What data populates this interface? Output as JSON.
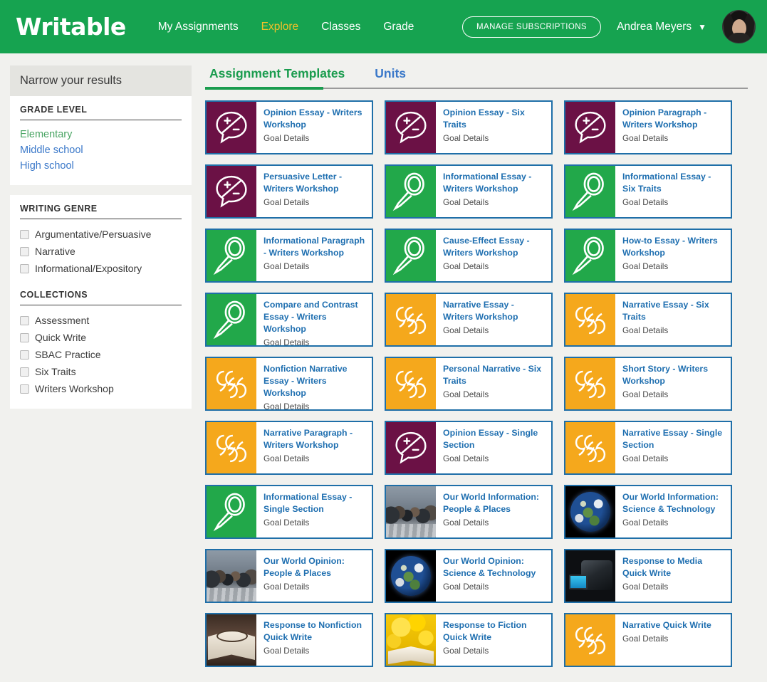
{
  "brand": {
    "name": "Writable"
  },
  "nav": {
    "links": [
      {
        "label": "My Assignments",
        "active": false
      },
      {
        "label": "Explore",
        "active": true
      },
      {
        "label": "Classes",
        "active": false
      },
      {
        "label": "Grade",
        "active": false
      }
    ],
    "manage_subscriptions": "MANAGE SUBSCRIPTIONS",
    "user_name": "Andrea Meyers",
    "caret": "▼"
  },
  "sidebar": {
    "title": "Narrow your results",
    "grade_level": {
      "heading": "GRADE LEVEL",
      "items": [
        {
          "label": "Elementary",
          "selected": true
        },
        {
          "label": "Middle school",
          "selected": false
        },
        {
          "label": "High school",
          "selected": false
        }
      ]
    },
    "writing_genre": {
      "heading": "WRITING GENRE",
      "items": [
        {
          "label": "Argumentative/Persuasive",
          "checked": false
        },
        {
          "label": "Narrative",
          "checked": false
        },
        {
          "label": "Informational/Expository",
          "checked": false
        }
      ]
    },
    "collections": {
      "heading": "COLLECTIONS",
      "items": [
        {
          "label": "Assessment",
          "checked": false
        },
        {
          "label": "Quick Write",
          "checked": false
        },
        {
          "label": "SBAC Practice",
          "checked": false
        },
        {
          "label": "Six Traits",
          "checked": false
        },
        {
          "label": "Writers Workshop",
          "checked": false
        }
      ]
    }
  },
  "main": {
    "tabs": [
      {
        "label": "Assignment Templates",
        "active": true
      },
      {
        "label": "Units",
        "active": false
      }
    ],
    "goal_details_label": "Goal Details",
    "cards": [
      {
        "title": "Opinion Essay - Writers Workshop",
        "icon": "opinion-icon",
        "goal": "Goal Details"
      },
      {
        "title": "Opinion Essay - Six Traits",
        "icon": "opinion-icon",
        "goal": "Goal Details"
      },
      {
        "title": "Opinion Paragraph - Writers Workshop",
        "icon": "opinion-icon",
        "goal": "Goal Details"
      },
      {
        "title": "Persuasive Letter - Writers Workshop",
        "icon": "opinion-icon",
        "goal": "Goal Details"
      },
      {
        "title": "Informational Essay - Writers Workshop",
        "icon": "magnify-icon",
        "goal": "Goal Details"
      },
      {
        "title": "Informational Essay - Six Traits",
        "icon": "magnify-icon",
        "goal": "Goal Details"
      },
      {
        "title": "Informational Paragraph - Writers Workshop",
        "icon": "magnify-icon",
        "goal": "Goal Details"
      },
      {
        "title": "Cause-Effect Essay - Writers Workshop",
        "icon": "magnify-icon",
        "goal": "Goal Details"
      },
      {
        "title": "How-to Essay - Writers Workshop",
        "icon": "magnify-icon",
        "goal": "Goal Details"
      },
      {
        "title": "Compare and Contrast Essay - Writers Workshop",
        "icon": "magnify-icon",
        "goal": "Goal Details"
      },
      {
        "title": "Narrative Essay - Writers Workshop",
        "icon": "quote-icon",
        "goal": "Goal Details"
      },
      {
        "title": "Narrative Essay - Six Traits",
        "icon": "quote-icon",
        "goal": "Goal Details"
      },
      {
        "title": "Nonfiction Narrative Essay - Writers Workshop",
        "icon": "quote-icon",
        "goal": "Goal Details"
      },
      {
        "title": "Personal Narrative - Six Traits",
        "icon": "quote-icon",
        "goal": "Goal Details"
      },
      {
        "title": "Short Story - Writers Workshop",
        "icon": "quote-icon",
        "goal": "Goal Details"
      },
      {
        "title": "Narrative Paragraph - Writers Workshop",
        "icon": "quote-icon",
        "goal": "Goal Details"
      },
      {
        "title": "Opinion Essay - Single Section",
        "icon": "opinion-icon",
        "goal": "Goal Details"
      },
      {
        "title": "Narrative Essay - Single Section",
        "icon": "quote-icon",
        "goal": "Goal Details"
      },
      {
        "title": "Informational Essay - Single Section",
        "icon": "magnify-icon",
        "goal": "Goal Details"
      },
      {
        "title": "Our World Information: People & Places",
        "icon": "crowd-photo",
        "goal": "Goal Details"
      },
      {
        "title": "Our World Information: Science & Technology",
        "icon": "earth-photo",
        "goal": "Goal Details"
      },
      {
        "title": "Our World Opinion: People & Places",
        "icon": "crowd-photo",
        "goal": "Goal Details"
      },
      {
        "title": "Our World Opinion: Science & Technology",
        "icon": "earth-photo",
        "goal": "Goal Details"
      },
      {
        "title": "Response to Media Quick Write",
        "icon": "media-photo",
        "goal": "Goal Details"
      },
      {
        "title": "Response to Nonfiction Quick Write",
        "icon": "book-photo",
        "goal": "Goal Details"
      },
      {
        "title": "Response to Fiction Quick Write",
        "icon": "yellow-book-photo",
        "goal": "Goal Details"
      },
      {
        "title": "Narrative Quick Write",
        "icon": "quote-icon",
        "goal": "Goal Details"
      }
    ]
  },
  "colors": {
    "brand_green": "#16a350",
    "accent_yellow": "#f3c02a",
    "card_border": "#1f6fa8",
    "title_blue": "#1f6fb0",
    "icon_purple": "#6b1145",
    "icon_green": "#22a84a",
    "icon_amber": "#f5a81c"
  }
}
